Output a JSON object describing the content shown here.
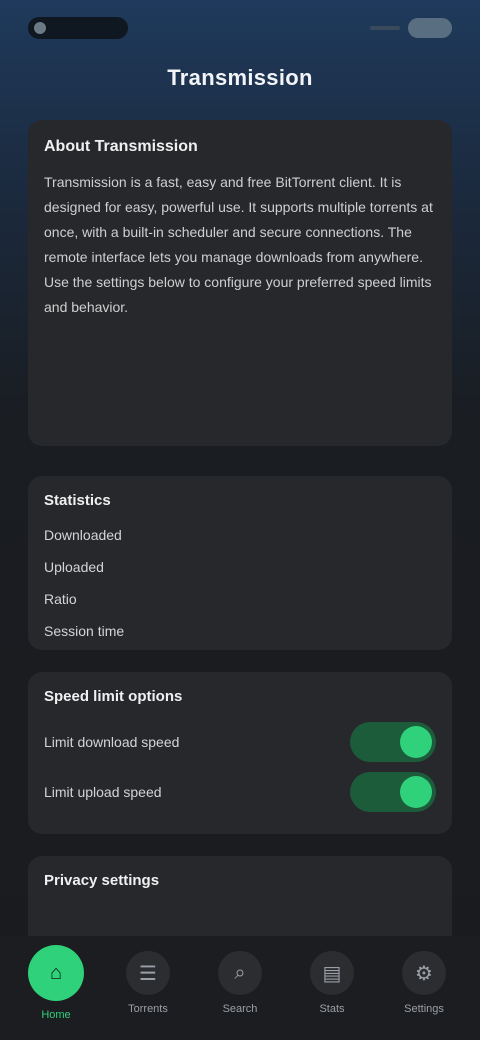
{
  "status": {
    "time": "",
    "indicators": [
      "signal-icon",
      "battery-icon"
    ]
  },
  "header": {
    "title": "Transmission"
  },
  "about": {
    "title": "About Transmission",
    "body": "Transmission is a fast, easy and free BitTorrent client. It is designed for easy, powerful use. It supports multiple torrents at once, with a built-in scheduler and secure connections. The remote interface lets you manage downloads from anywhere. Use the settings below to configure your preferred speed limits and behavior."
  },
  "stats": {
    "title": "Statistics",
    "rows": [
      {
        "label": "Downloaded",
        "value": ""
      },
      {
        "label": "Uploaded",
        "value": ""
      },
      {
        "label": "Ratio",
        "value": ""
      },
      {
        "label": "Session time",
        "value": ""
      }
    ]
  },
  "tools": {
    "title": "Speed limit options",
    "items": [
      {
        "label": "Limit download speed"
      },
      {
        "label": "Limit upload speed"
      }
    ]
  },
  "privacy": {
    "title": "Privacy settings",
    "body": ""
  },
  "nav": {
    "items": [
      {
        "label": "Home",
        "icon": "home-icon",
        "active": true
      },
      {
        "label": "Torrents",
        "icon": "list-icon"
      },
      {
        "label": "Search",
        "icon": "search-icon"
      },
      {
        "label": "Stats",
        "icon": "chart-icon"
      },
      {
        "label": "Settings",
        "icon": "gear-icon"
      }
    ]
  },
  "colors": {
    "accent": "#2fd17a",
    "card": "#26282c",
    "background": "#1a1b1e"
  }
}
